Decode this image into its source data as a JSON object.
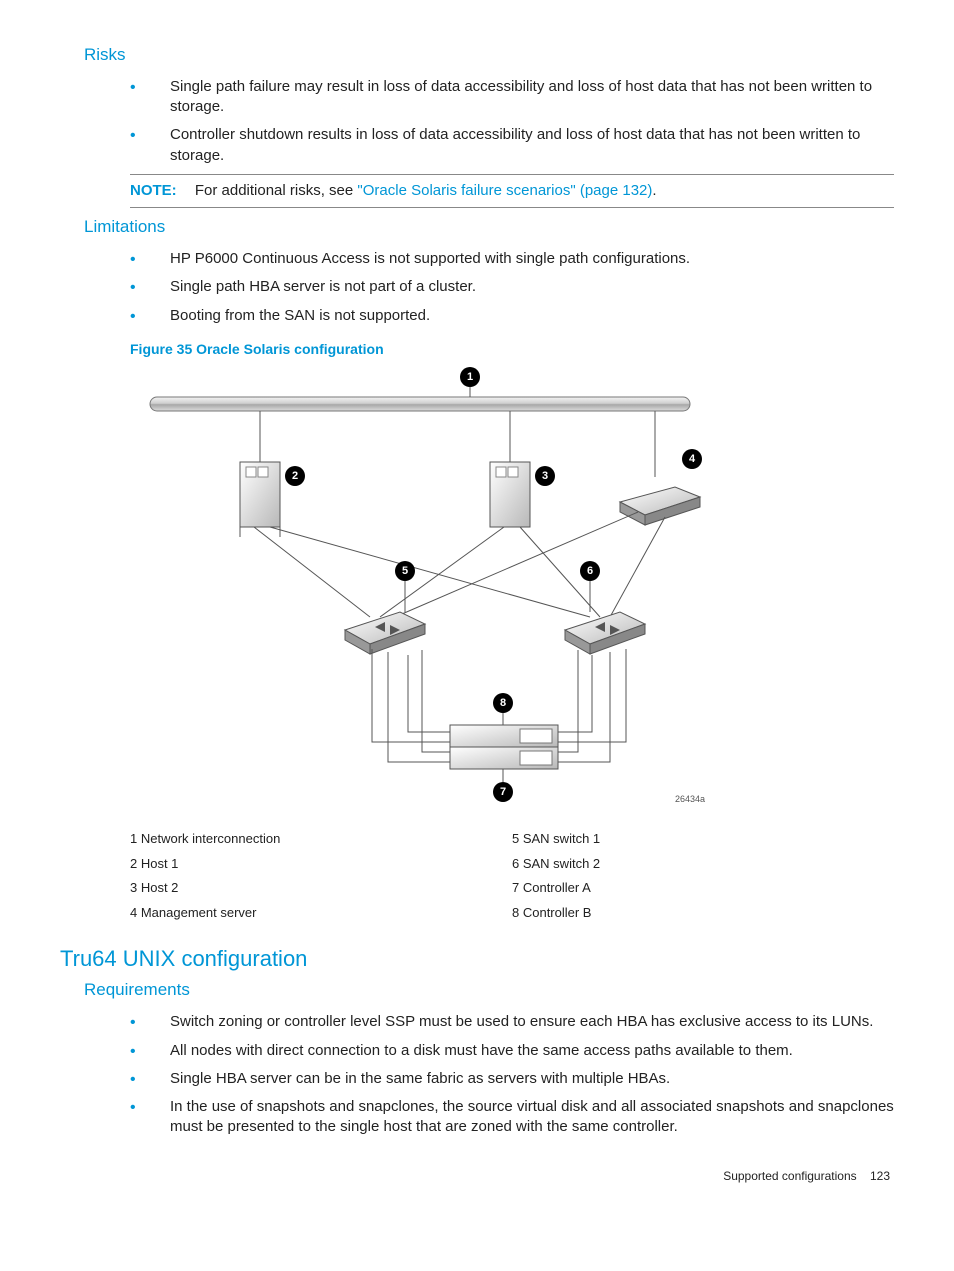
{
  "risks": {
    "heading": "Risks",
    "items": [
      "Single path failure may result in loss of data accessibility and loss of host data that has not been written to storage.",
      "Controller shutdown results in loss of data accessibility and loss of host data that has not been written to storage."
    ]
  },
  "note": {
    "label": "NOTE:",
    "pre": "For additional risks, see ",
    "link": "\"Oracle Solaris failure scenarios\" (page 132)",
    "post": "."
  },
  "limitations": {
    "heading": "Limitations",
    "items": [
      "HP P6000 Continuous Access is not supported with single path configurations.",
      "Single path HBA server is not part of a cluster.",
      "Booting from the SAN is not supported."
    ]
  },
  "figure": {
    "caption": "Figure 35 Oracle Solaris configuration",
    "image_id": "26434a",
    "legend_left": [
      "1 Network interconnection",
      "2 Host 1",
      "3 Host 2",
      "4 Management server"
    ],
    "legend_right": [
      "5 SAN switch 1",
      "6 SAN switch 2",
      "7 Controller A",
      "8 Controller B"
    ]
  },
  "tru64": {
    "heading": "Tru64 UNIX configuration",
    "req_heading": "Requirements",
    "items": [
      "Switch zoning or controller level SSP must be used to ensure each HBA has exclusive access to its LUNs.",
      "All nodes with direct connection to a disk must have the same access paths available to them.",
      "Single HBA server can be in the same fabric as servers with multiple HBAs.",
      "In the use of snapshots and snapclones, the source virtual disk and all associated snapshots and snapclones must be presented to the single host that are zoned with the same controller."
    ]
  },
  "footer": {
    "section": "Supported configurations",
    "page": "123"
  }
}
